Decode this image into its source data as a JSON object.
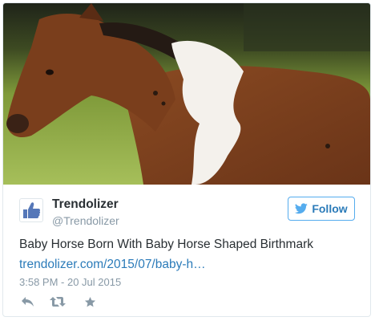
{
  "author": {
    "name": "Trendolizer",
    "handle": "@Trendolizer",
    "avatar_icon": "thumbs-up-icon"
  },
  "follow_button": {
    "label": "Follow",
    "icon": "twitter-bird-icon"
  },
  "tweet": {
    "text": "Baby Horse Born With Baby Horse Shaped Birthmark",
    "link": "trendolizer.com/2015/07/baby-h…",
    "timestamp": "3:58 PM - 20 Jul 2015"
  },
  "actions": [
    {
      "icon": "reply-icon"
    },
    {
      "icon": "retweet-icon"
    },
    {
      "icon": "favorite-star-icon"
    }
  ],
  "colors": {
    "link": "#2b7bb9",
    "muted": "#8899a6",
    "border": "#e1e8ed",
    "follow_border": "#55acee"
  }
}
